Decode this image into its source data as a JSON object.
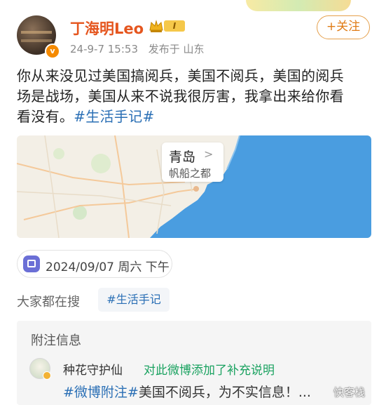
{
  "post": {
    "username": "丁海明Leo",
    "level": "I",
    "verified_mark": "v",
    "time": "24-9-7 15:53",
    "location": "发布于 山东",
    "follow_label": "+关注",
    "text_lines": [
      "你从来没见过美国搞阅兵，美国不阅兵，美国的阅兵",
      "场是战场，美国从来不说我很厉害，我拿出来给你看"
    ],
    "text_line3_prefix": "看没有。",
    "hashtag": "#生活手记#"
  },
  "map": {
    "city": "青岛",
    "subtitle": "帆船之都",
    "chevron": ">"
  },
  "date_chip": {
    "icon": "calendar-icon",
    "label": "2024/09/07 周六 下午"
  },
  "trending": {
    "label": "大家都在搜",
    "tag": "#生活手记"
  },
  "note": {
    "title": "附注信息",
    "user": "种花守护仙",
    "action": "对此微博添加了补充说明",
    "body_tag": "#微博附注#",
    "body_text": "美国不阅兵，为不实信息！..."
  },
  "watermark": "快客栈",
  "colors": {
    "username": "#e5561f",
    "link": "#2a6fb5",
    "follow": "#e07b15",
    "note_action": "#1aa260",
    "sea": "#4a9de0"
  }
}
